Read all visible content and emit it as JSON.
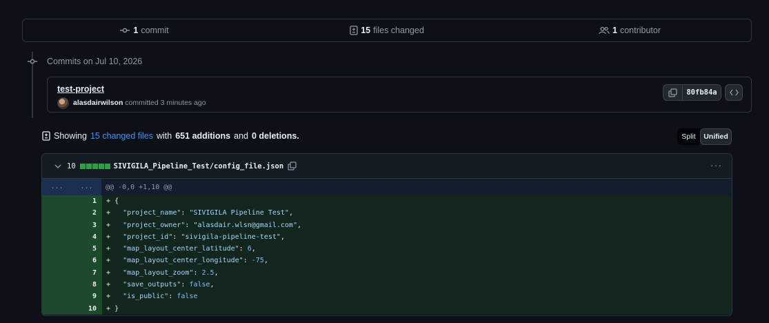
{
  "summary": {
    "commits_count": "1",
    "commits_label": "commit",
    "files_count": "15",
    "files_label": "files changed",
    "contributors_count": "1",
    "contributors_label": "contributor"
  },
  "timeline": {
    "heading": "Commits on Jul 10, 2026"
  },
  "commit": {
    "title": "test-project",
    "author": "alasdairwilson",
    "action_text": "committed 3 minutes ago",
    "sha": "80fb84a"
  },
  "showing": {
    "prefix": "Showing",
    "link_text": "15 changed files",
    "with_text": "with",
    "additions": "651 additions",
    "and_text": "and",
    "deletions": "0 deletions."
  },
  "view_toggle": {
    "split": "Split",
    "unified": "Unified"
  },
  "file": {
    "changes_count": "10",
    "path": "SIVIGILA_Pipeline_Test/config_file.json",
    "hunk_gutter_old": "...",
    "hunk_gutter_new": "...",
    "hunk_header": "@@ -0,0 +1,10 @@",
    "menu_glyph": "···",
    "lines": [
      {
        "num": "1",
        "marker": "+",
        "text": "{"
      },
      {
        "num": "2",
        "marker": "+",
        "key": "\"project_name\"",
        "sep": ": ",
        "value": "\"SIVIGILA Pipeline Test\"",
        "tail": ","
      },
      {
        "num": "3",
        "marker": "+",
        "key": "\"project_owner\"",
        "sep": ": ",
        "value": "\"alasdair.wlsn@gmail.com\"",
        "tail": ","
      },
      {
        "num": "4",
        "marker": "+",
        "key": "\"project_id\"",
        "sep": ": ",
        "value": "\"sivigila-pipeline-test\"",
        "tail": ","
      },
      {
        "num": "5",
        "marker": "+",
        "key": "\"map_layout_center_latitude\"",
        "sep": ": ",
        "value": "6",
        "tail": ","
      },
      {
        "num": "6",
        "marker": "+",
        "key": "\"map_layout_center_longitude\"",
        "sep": ": ",
        "value": "-75",
        "tail": ","
      },
      {
        "num": "7",
        "marker": "+",
        "key": "\"map_layout_zoom\"",
        "sep": ": ",
        "value": "2.5",
        "tail": ","
      },
      {
        "num": "8",
        "marker": "+",
        "key": "\"save_outputs\"",
        "sep": ": ",
        "value": "false",
        "tail": ","
      },
      {
        "num": "9",
        "marker": "+",
        "key": "\"is_public\"",
        "sep": ": ",
        "value": "false",
        "tail": ""
      },
      {
        "num": "10",
        "marker": "+",
        "text": "}"
      }
    ]
  },
  "colors": {
    "background": "#0d1117",
    "border": "#30363d",
    "accent_link": "#4493f8",
    "addition_bg": "#12261e",
    "addition_gutter": "#1e4a2c",
    "addition_bar": "#2ea043"
  }
}
